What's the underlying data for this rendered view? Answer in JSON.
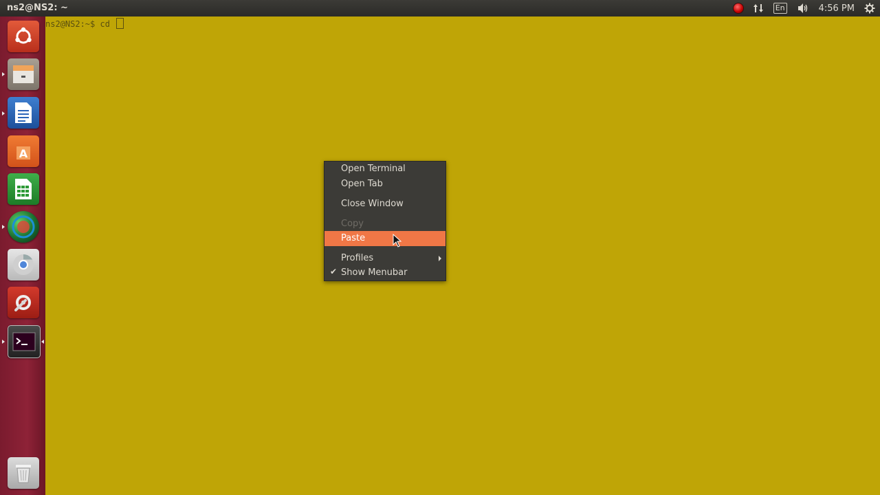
{
  "top_panel": {
    "window_title": "ns2@NS2: ~",
    "indicators": {
      "recording_icon": "record-indicator-icon",
      "network_icon": "network-updown-icon",
      "keyboard_layout": "En",
      "volume_icon": "volume-icon",
      "clock": "4:56 PM",
      "settings_icon": "gear-icon"
    }
  },
  "launcher": {
    "items": [
      {
        "icon": "dash-home-icon"
      },
      {
        "icon": "files-icon"
      },
      {
        "icon": "writer-icon"
      },
      {
        "icon": "software-center-icon"
      },
      {
        "icon": "calc-icon"
      },
      {
        "icon": "globe-app-icon"
      },
      {
        "icon": "chrome-icon"
      },
      {
        "icon": "system-settings-icon"
      },
      {
        "icon": "terminal-icon"
      },
      {
        "icon": "trash-icon"
      }
    ]
  },
  "terminal": {
    "prompt": "ns2@NS2:~$ cd "
  },
  "context_menu": {
    "items": [
      {
        "label": "Open Terminal",
        "enabled": true
      },
      {
        "label": "Open Tab",
        "enabled": true
      },
      {
        "label": "Close Window",
        "enabled": true
      },
      {
        "label": "Copy",
        "enabled": false
      },
      {
        "label": "Paste",
        "enabled": true,
        "highlighted": true
      },
      {
        "label": "Profiles",
        "enabled": true,
        "submenu": true
      },
      {
        "label": "Show Menubar",
        "enabled": true,
        "checked": true
      }
    ]
  },
  "colors": {
    "terminal_bg": "#bfa506",
    "launcher_bg": "#8e2237",
    "menu_bg": "#3c3b37",
    "menu_highlight": "#f07746",
    "panel_bg": "#3c3b37"
  }
}
